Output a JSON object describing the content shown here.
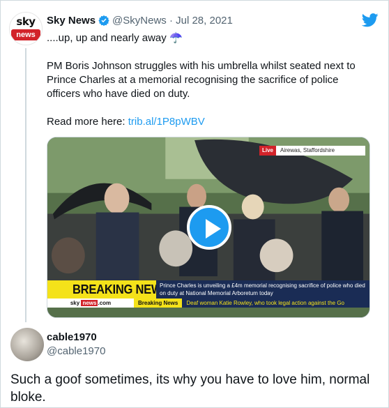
{
  "parent_tweet": {
    "display_name": "Sky News",
    "handle_date": "@SkyNews · Jul 28, 2021",
    "line1": "....up, up and nearly away ☂️",
    "line2": "PM Boris Johnson struggles with his umbrella whilst seated next to Prince Charles at a memorial recognising the sacrifice of police officers who have died on duty.",
    "read_more_label": "Read more here: ",
    "link_text": "trib.al/1P8pWBV",
    "avatar_top": "sky",
    "avatar_bottom": "news"
  },
  "video": {
    "live_label": "Live",
    "location": "Airewas, Staffordshire",
    "breaking_title": "BREAKING NEWS",
    "breaking_sub": "Prince Charles is unveiling a £4m memorial recognising sacrifice of police who died on duty at National Memorial Arboretum today",
    "ticker_brand_left": "sky",
    "ticker_brand_news": "news",
    "ticker_brand_right": ".com",
    "ticker_bn": "Breaking News",
    "ticker_text": "Deaf woman Katie Rowley, who took legal action against the Go"
  },
  "reply": {
    "display_name": "cable1970",
    "handle": "@cable1970",
    "text": "Such a goof sometimes, its why you have to love him, normal bloke."
  },
  "colors": {
    "link": "#1d9bf0",
    "verified": "#1d9bf0",
    "sky_red": "#d2232a",
    "breaking_yellow": "#f4e21a",
    "sky_navy": "#1a2c55"
  },
  "icons": [
    "verified-icon",
    "twitter-bird-icon",
    "play-icon"
  ]
}
